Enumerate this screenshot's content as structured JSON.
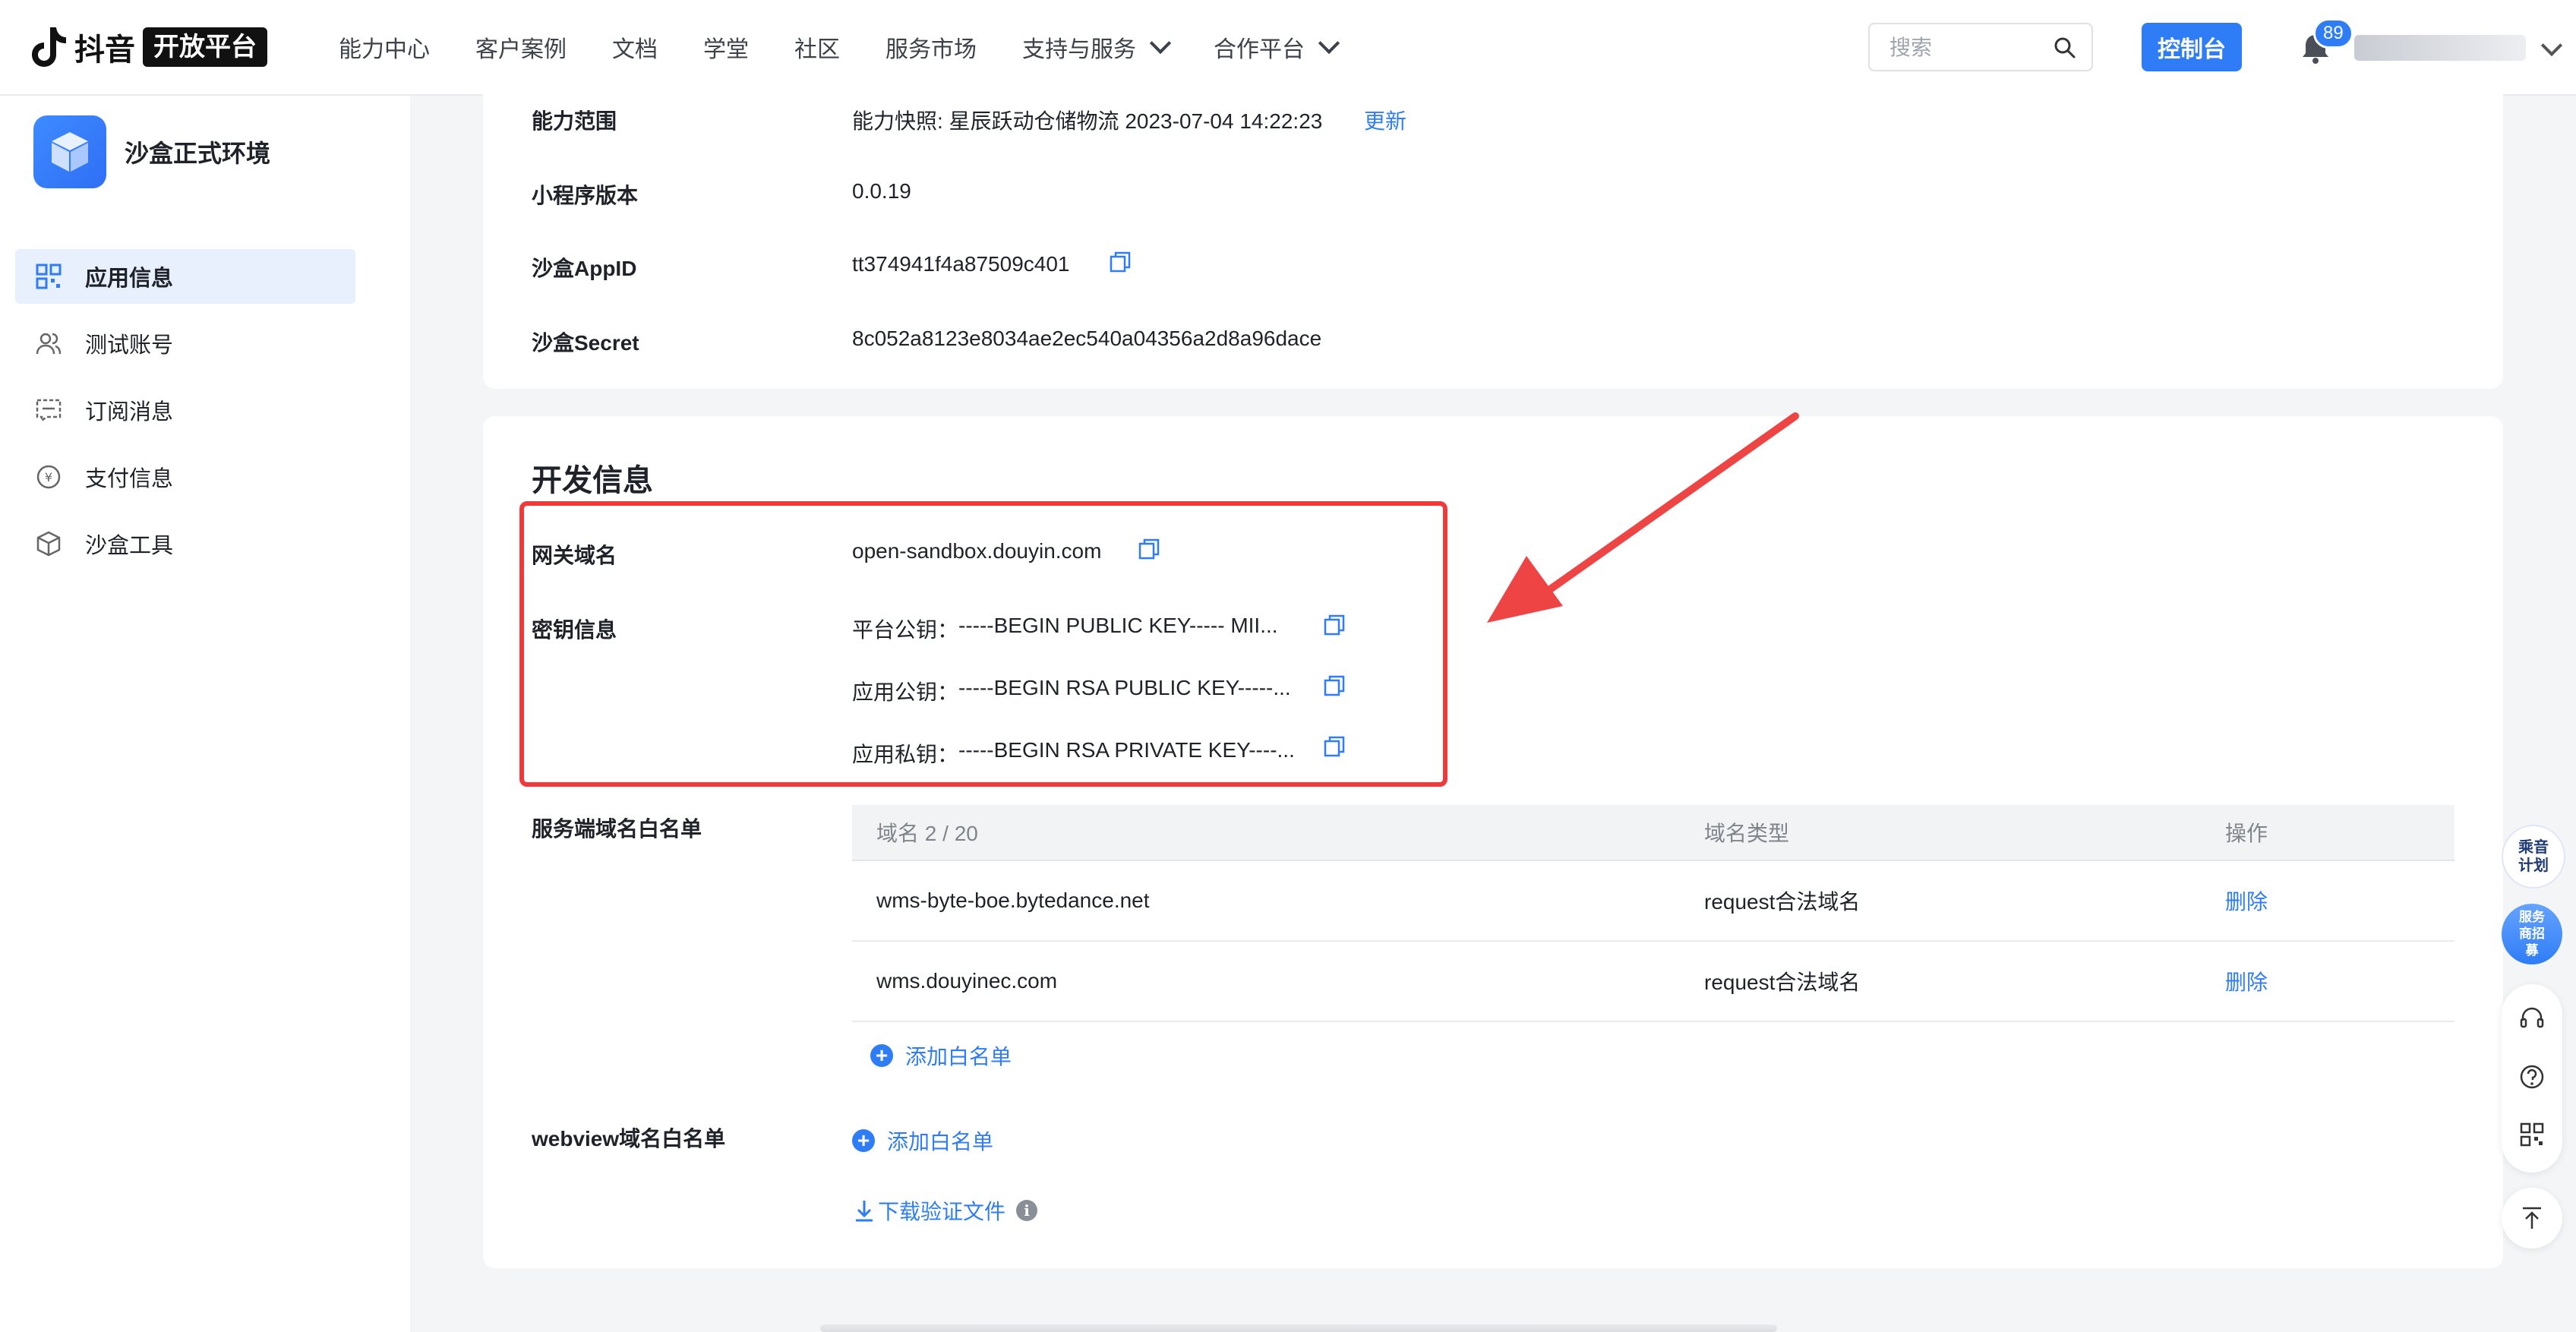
{
  "header": {
    "logo_word": "抖音",
    "logo_badge": "开放平台",
    "nav": [
      {
        "label": "能力中心",
        "dropdown": false
      },
      {
        "label": "客户案例",
        "dropdown": false
      },
      {
        "label": "文档",
        "dropdown": false
      },
      {
        "label": "学堂",
        "dropdown": false
      },
      {
        "label": "社区",
        "dropdown": false
      },
      {
        "label": "服务市场",
        "dropdown": false
      },
      {
        "label": "支持与服务",
        "dropdown": true
      },
      {
        "label": "合作平台",
        "dropdown": true
      }
    ],
    "search_placeholder": "搜索",
    "console_label": "控制台",
    "notification_count": "89"
  },
  "sidebar": {
    "app_name": "沙盒正式环境",
    "items": [
      {
        "label": "应用信息",
        "icon": "app-grid-icon",
        "active": true
      },
      {
        "label": "测试账号",
        "icon": "users-icon",
        "active": false
      },
      {
        "label": "订阅消息",
        "icon": "message-icon",
        "active": false
      },
      {
        "label": "支付信息",
        "icon": "yen-coin-icon",
        "active": false
      },
      {
        "label": "沙盒工具",
        "icon": "cube-icon",
        "active": false
      }
    ]
  },
  "basic": {
    "scope_label": "能力范围",
    "scope_value": "能力快照: 星辰跃动仓储物流 2023-07-04 14:22:23",
    "scope_update": "更新",
    "version_label": "小程序版本",
    "version_value": "0.0.19",
    "appid_label": "沙盒AppID",
    "appid_value": "tt374941f4a87509c401",
    "secret_label": "沙盒Secret",
    "secret_value": "8c052a8123e8034ae2ec540a04356a2d8a96dace"
  },
  "dev": {
    "title": "开发信息",
    "gateway_label": "网关域名",
    "gateway_value": "open-sandbox.douyin.com",
    "key_label": "密钥信息",
    "keys": [
      {
        "name": "平台公钥：",
        "value": "-----BEGIN PUBLIC KEY----- MII..."
      },
      {
        "name": "应用公钥：",
        "value": "-----BEGIN RSA PUBLIC KEY-----..."
      },
      {
        "name": "应用私钥：",
        "value": "-----BEGIN RSA PRIVATE KEY----..."
      }
    ],
    "server_whitelist_label": "服务端域名白名单",
    "table_headers": [
      "域名 2 / 20",
      "域名类型",
      "操作"
    ],
    "table_rows": [
      {
        "domain": "wms-byte-boe.bytedance.net",
        "type": "request合法域名",
        "action": "删除"
      },
      {
        "domain": "wms.douyinec.com",
        "type": "request合法域名",
        "action": "删除"
      }
    ],
    "add_whitelist": "添加白名单",
    "webview_label": "webview域名白名单",
    "webview_add": "添加白名单",
    "download": "下载验证文件"
  },
  "float": {
    "plan_label": "乘音计划",
    "recruit_label": "服务商招募"
  },
  "colors": {
    "accent": "#2e7df6",
    "highlight": "#ee3a3a",
    "arrow": "#ee4444"
  }
}
